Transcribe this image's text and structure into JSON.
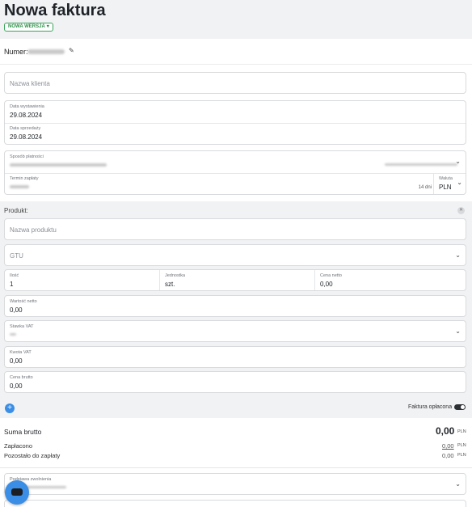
{
  "header": {
    "title": "Nowa faktura",
    "badge": "NOWA WERSJA",
    "badge_caret": "▾"
  },
  "numer": {
    "label": "Numer:"
  },
  "client": {
    "placeholder": "Nazwa klienta"
  },
  "dates": {
    "issue_label": "Data wystawienia",
    "issue_value": "29.08.2024",
    "sale_label": "Data sprzedaży",
    "sale_value": "29.08.2024"
  },
  "payment": {
    "method_label": "Sposób płatności",
    "term_label": "Termin zapłaty",
    "term_days": "14 dni",
    "currency_label": "Waluta",
    "currency_value": "PLN"
  },
  "product_section": {
    "label": "Produkt:",
    "name_placeholder": "Nazwa produktu",
    "gtu_placeholder": "GTU",
    "qty_label": "Ilość",
    "qty_value": "1",
    "unit_label": "Jednostka",
    "unit_value": "szt.",
    "net_price_label": "Cena netto",
    "net_price_value": "0,00",
    "net_value_label": "Wartość netto",
    "net_value_value": "0,00",
    "vat_rate_label": "Stawka VAT",
    "vat_amount_label": "Kwota VAT",
    "vat_amount_value": "0,00",
    "gross_price_label": "Cena brutto",
    "gross_price_value": "0,00"
  },
  "paid_toggle": {
    "label": "Faktura opłacona"
  },
  "summary": {
    "gross_label": "Suma brutto",
    "gross_value": "0,00",
    "currency": "PLN",
    "paid_label": "Zapłacono",
    "paid_value": "0,00",
    "remaining_label": "Pozostało do zapłaty",
    "remaining_value": "0,00"
  },
  "exemption": {
    "label": "Podstawa zwolnienia"
  },
  "icons": {
    "edit": "pencil-icon",
    "chevron": "chevron-down-icon",
    "plus": "plus-icon",
    "close": "close-icon",
    "chat": "chat-icon"
  }
}
